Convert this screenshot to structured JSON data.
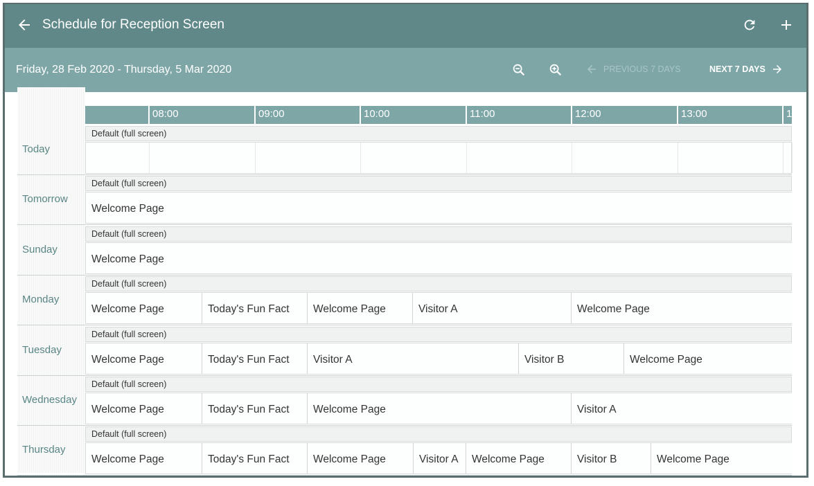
{
  "header": {
    "title": "Schedule for Reception Screen"
  },
  "toolbar": {
    "date_range": "Friday, 28 Feb 2020 - Thursday, 5 Mar 2020",
    "prev_label": "PREVIOUS 7 DAYS",
    "next_label": "NEXT 7 DAYS"
  },
  "timeline": {
    "hours": [
      "08:00",
      "09:00",
      "10:00",
      "11:00",
      "12:00",
      "13:00",
      "1"
    ]
  },
  "colors": {
    "titlebar": "#608888",
    "toolbar": "#7ea6a6",
    "timeline": "#7ea6a6",
    "day_label": "#5a8585"
  },
  "rows": [
    {
      "label": "Today",
      "layout": "Default (full screen)",
      "slots": []
    },
    {
      "label": "Tomorrow",
      "layout": "Default (full screen)",
      "slots": [
        {
          "name": "Welcome Page"
        }
      ]
    },
    {
      "label": "Sunday",
      "layout": "Default (full screen)",
      "slots": [
        {
          "name": "Welcome Page"
        }
      ]
    },
    {
      "label": "Monday",
      "layout": "Default (full screen)",
      "slots": [
        {
          "name": "Welcome Page"
        },
        {
          "name": "Today's Fun Fact"
        },
        {
          "name": "Welcome Page"
        },
        {
          "name": "Visitor A"
        },
        {
          "name": "Welcome Page"
        }
      ]
    },
    {
      "label": "Tuesday",
      "layout": "Default (full screen)",
      "slots": [
        {
          "name": "Welcome Page"
        },
        {
          "name": "Today's Fun Fact"
        },
        {
          "name": "Visitor A"
        },
        {
          "name": "Visitor B"
        },
        {
          "name": "Welcome Page"
        }
      ]
    },
    {
      "label": "Wednesday",
      "layout": "Default (full screen)",
      "slots": [
        {
          "name": "Welcome Page"
        },
        {
          "name": "Today's Fun Fact"
        },
        {
          "name": "Welcome Page"
        },
        {
          "name": "Visitor A"
        }
      ]
    },
    {
      "label": "Thursday",
      "layout": "Default (full screen)",
      "slots": [
        {
          "name": "Welcome Page"
        },
        {
          "name": "Today's Fun Fact"
        },
        {
          "name": "Welcome Page"
        },
        {
          "name": "Visitor A"
        },
        {
          "name": "Welcome Page"
        },
        {
          "name": "Visitor B"
        },
        {
          "name": "Welcome Page"
        }
      ]
    }
  ]
}
